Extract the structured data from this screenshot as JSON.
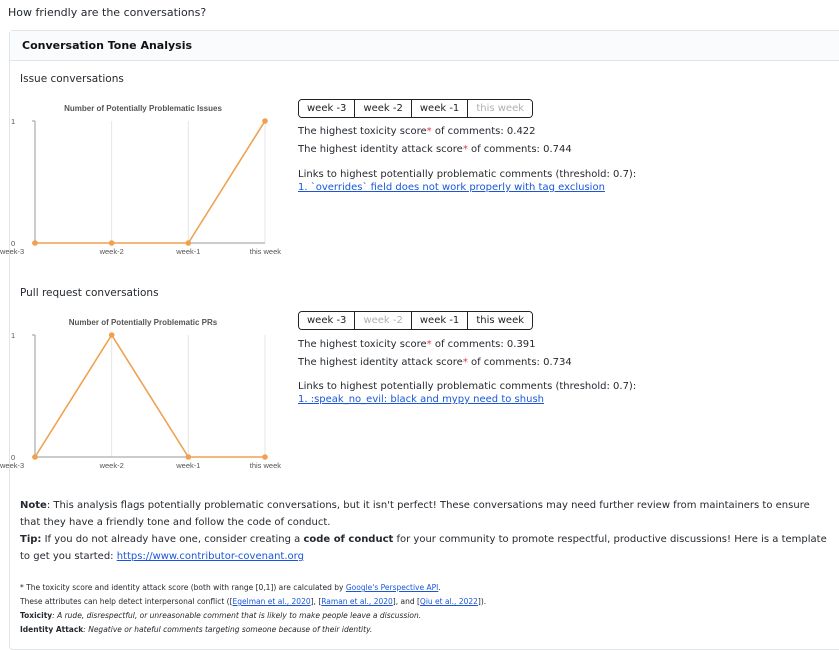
{
  "page": {
    "question": "How friendly are the conversations?"
  },
  "card": {
    "title": "Conversation Tone Analysis"
  },
  "issues": {
    "label": "Issue conversations",
    "weeks": [
      {
        "label": "week -3",
        "enabled": true
      },
      {
        "label": "week -2",
        "enabled": true
      },
      {
        "label": "week -1",
        "enabled": true
      },
      {
        "label": "this week",
        "enabled": false
      }
    ],
    "toxicity_prefix": "The highest toxicity score",
    "toxicity_suffix": " of comments: 0.422",
    "identity_prefix": "The highest identity attack score",
    "identity_suffix": " of comments: 0.744",
    "links_label": "Links to highest potentially problematic comments (threshold: 0.7):",
    "link": "1. `overrides` field does not work properly with tag exclusion"
  },
  "prs": {
    "label": "Pull request conversations",
    "weeks": [
      {
        "label": "week -3",
        "enabled": true
      },
      {
        "label": "week -2",
        "enabled": false
      },
      {
        "label": "week -1",
        "enabled": true
      },
      {
        "label": "this week",
        "enabled": true
      }
    ],
    "toxicity_prefix": "The highest toxicity score",
    "toxicity_suffix": " of comments: 0.391",
    "identity_prefix": "The highest identity attack score",
    "identity_suffix": " of comments: 0.734",
    "links_label": "Links to highest potentially problematic comments (threshold: 0.7):",
    "link": "1. :speak_no_evil: black and mypy need to shush"
  },
  "star": "*",
  "note": {
    "bold": "Note",
    "text": ": This analysis flags potentially problematic conversations, but it isn't perfect! These conversations may need further review from maintainers to ensure that they have a friendly tone and follow the code of conduct."
  },
  "tip": {
    "bold": "Tip:",
    "text1": " If you do not already have one, consider creating a ",
    "bold2": "code of conduct",
    "text2": " for your community to promote respectful, productive discussions! Here is a template to get you started: ",
    "link": "https://www.contributor-covenant.org"
  },
  "footnotes": {
    "line1_prefix": "* The toxicity score and identity attack score (both with range [0,1]) are calculated by ",
    "line1_link": "Google's Perspective API",
    "line1_suffix": ".",
    "line2_prefix": "These attributes can help detect interpersonal conflict ([",
    "line2_link1": "Egelman et al., 2020",
    "line2_mid1": "], [",
    "line2_link2": "Raman et al., 2020",
    "line2_mid2": "], and [",
    "line2_link3": "Qiu et al., 2022",
    "line2_suffix": "]).",
    "toxicity_term": "Toxicity",
    "toxicity_def": ": A rude, disrespectful, or unreasonable comment that is likely to make people leave a discussion.",
    "identity_term": "Identity Attack",
    "identity_def": ": Negative or hateful comments targeting someone because of their identity."
  },
  "colors": {
    "line": "#f0a150",
    "grid": "#e5e5e5",
    "axis": "#999999"
  },
  "chart_data": [
    {
      "type": "line",
      "title": "Number of Potentially Problematic Issues",
      "categories": [
        "week-3",
        "week-2",
        "week-1",
        "this week"
      ],
      "values": [
        0,
        0,
        0,
        1
      ],
      "ylim": [
        0,
        1
      ],
      "yticks": [
        "0",
        "1"
      ],
      "xlabel": "",
      "ylabel": "",
      "grid": true
    },
    {
      "type": "line",
      "title": "Number of Potentially Problematic PRs",
      "categories": [
        "week-3",
        "week-2",
        "week-1",
        "this week"
      ],
      "values": [
        0,
        1,
        0,
        0
      ],
      "ylim": [
        0,
        1
      ],
      "yticks": [
        "0",
        "1"
      ],
      "xlabel": "",
      "ylabel": "",
      "grid": true
    }
  ]
}
